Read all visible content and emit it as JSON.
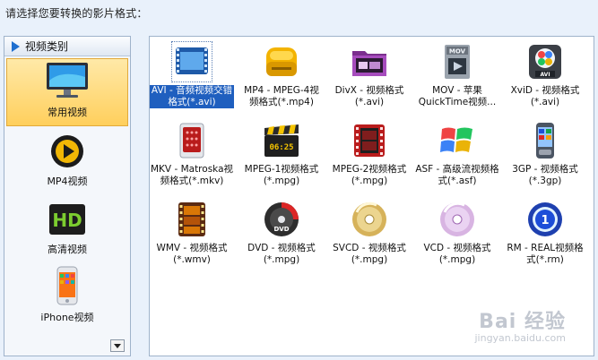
{
  "prompt": "请选择您要转换的影片格式：",
  "sidebar": {
    "header": "视频类别",
    "items": [
      {
        "label": "常用视频",
        "icon": "monitor-icon"
      },
      {
        "label": "MP4视频",
        "icon": "mp4-player-icon"
      },
      {
        "label": "高清视频",
        "icon": "hd-icon"
      },
      {
        "label": "iPhone视频",
        "icon": "iphone-icon"
      }
    ],
    "active_index": 0
  },
  "formats": [
    {
      "label": "AVI - 音频视频交错格式(*.avi)",
      "icon": "film-reel-icon",
      "selected": true
    },
    {
      "label": "MP4 - MPEG-4视频格式(*.mp4)",
      "icon": "mp4-drive-icon"
    },
    {
      "label": "DivX - 视频格式(*.avi)",
      "icon": "divx-folder-icon"
    },
    {
      "label": "MOV - 苹果QuickTime视频...",
      "icon": "mov-icon"
    },
    {
      "label": "XviD - 视频格式(*.avi)",
      "icon": "xvid-icon"
    },
    {
      "label": "MKV - Matroska视频格式(*.mkv)",
      "icon": "mkv-icon"
    },
    {
      "label": "MPEG-1视频格式(*.mpg)",
      "icon": "clapperboard-icon"
    },
    {
      "label": "MPEG-2视频格式(*.mpg)",
      "icon": "mpeg2-film-icon"
    },
    {
      "label": "ASF - 高级流视频格式(*.asf)",
      "icon": "windows-logo-icon"
    },
    {
      "label": "3GP - 视频格式(*.3gp)",
      "icon": "phone-icon"
    },
    {
      "label": "WMV - 视频格式(*.wmv)",
      "icon": "wmv-film-icon"
    },
    {
      "label": "DVD - 视频格式(*.mpg)",
      "icon": "dvd-disc-icon"
    },
    {
      "label": "SVCD - 视频格式(*.mpg)",
      "icon": "svcd-disc-icon"
    },
    {
      "label": "VCD - 视频格式(*.mpg)",
      "icon": "vcd-disc-icon"
    },
    {
      "label": "RM - REAL视频格式(*.rm)",
      "icon": "realmedia-icon"
    }
  ],
  "clock_display": "06:25",
  "watermark": {
    "brand": "Bai 经验",
    "domain": "jingyan.baidu.com"
  },
  "colors": {
    "selection": "#1f5fbf",
    "active_category": "#ffcf5c"
  }
}
